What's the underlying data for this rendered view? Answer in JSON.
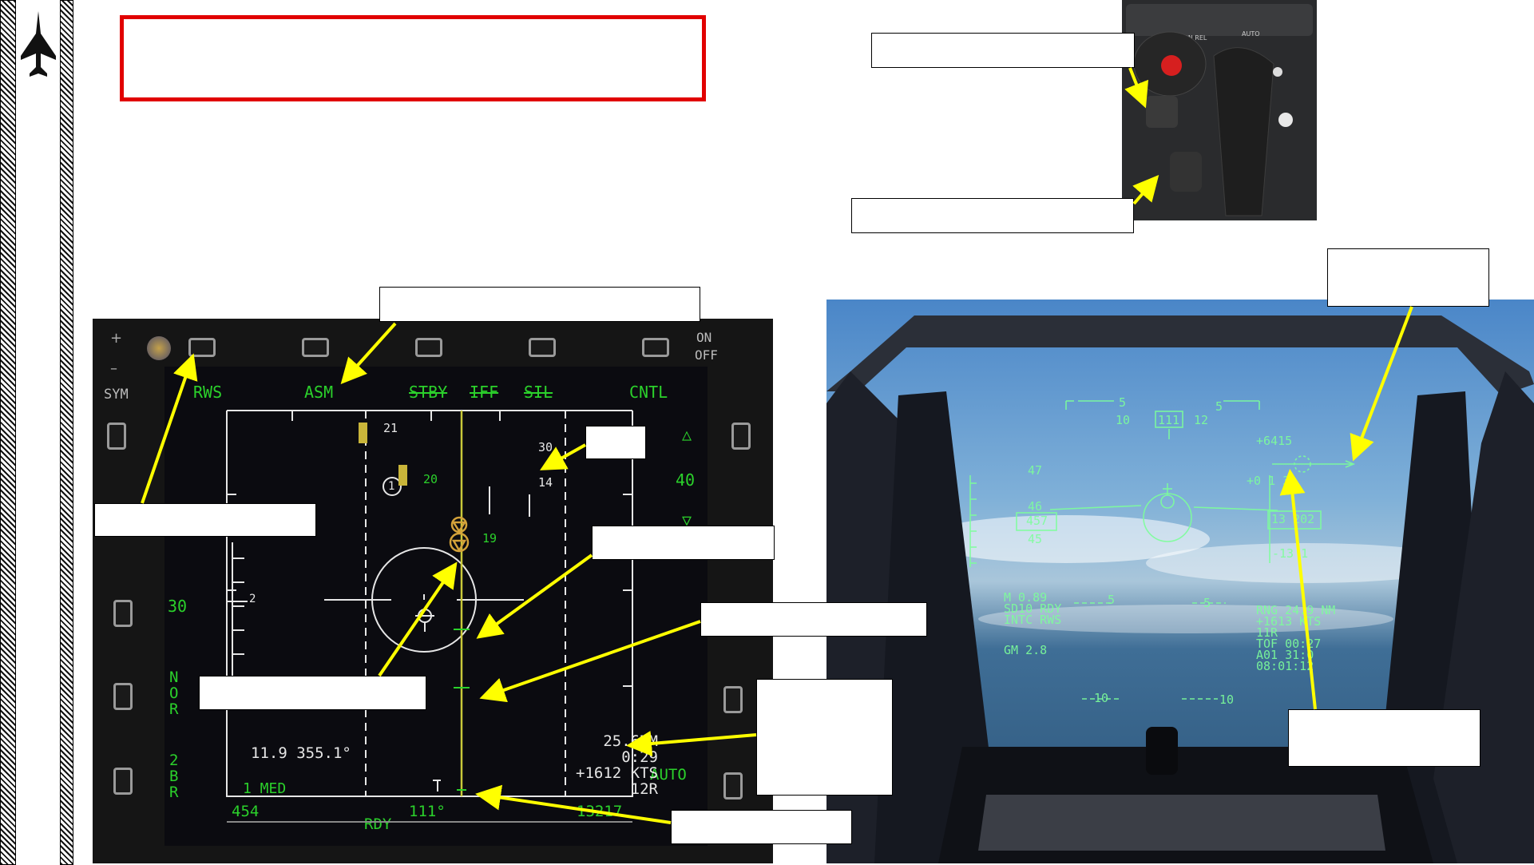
{
  "mfd": {
    "top_labels": [
      "RWS",
      "ASM",
      "STBY",
      "IFF",
      "SIL",
      "CNTL"
    ],
    "sym": "SYM",
    "on_off": [
      "ON",
      "OFF"
    ],
    "left": {
      "range": "30",
      "nor": [
        "N",
        "O",
        "R"
      ],
      "bar": [
        "2",
        "B",
        "R"
      ]
    },
    "right": {
      "range": "40",
      "auto": "AUTO"
    },
    "bottom": {
      "speed": "454",
      "status": "RDY",
      "heading": "111°",
      "altitude": "13217"
    },
    "bullseye": "11.9 355.1°",
    "target_info": [
      "25.6NM",
      "0:29",
      "+1612 KTS",
      "12R"
    ],
    "elev_mark": "1 MED",
    "contacts": {
      "c21": "21",
      "c20": "20",
      "c19": "19",
      "rank": "1",
      "alt_hi": "30",
      "alt_lo": "14",
      "elev_cursor": "2"
    }
  },
  "hud": {
    "heading_tape": [
      "10",
      "111",
      "12"
    ],
    "ladder": [
      "5",
      "5"
    ],
    "alt_top": "+6415",
    "alt_rate": "+0  1 3",
    "speed_ticks": [
      "47",
      "46",
      "45"
    ],
    "speed_box": "457",
    "alt_box": "13 202",
    "alt_low": "-13 1",
    "left_block": [
      "M 0.89",
      "SD10   RDY",
      "INTC    RWS",
      "",
      "GM 2.8"
    ],
    "right_block": [
      "RNG 24.9 NM",
      "+1613 KTS",
      "11R",
      "TOF 00:27",
      "A01 31:0",
      "08:01:12"
    ],
    "pitch_lines": [
      "5",
      "5",
      "10",
      "10"
    ]
  },
  "colors": {
    "red_box": "#e10000",
    "mfd_green": "#2bd12b",
    "hud_green": "#7dff9a",
    "arrow_yellow": "#ffff00"
  }
}
